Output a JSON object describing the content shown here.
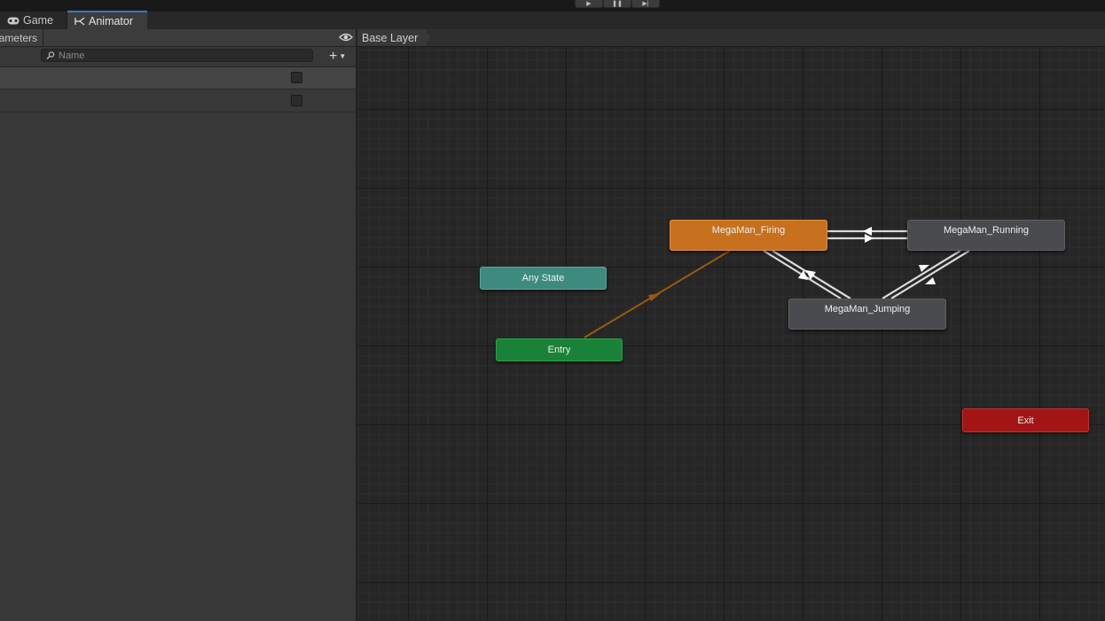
{
  "toolbar": {
    "play_icon": "▶",
    "pause_icon": "❚❚",
    "step_icon": "▶|"
  },
  "tabs": [
    {
      "label": "Game",
      "icon": "gamepad-icon"
    },
    {
      "label": "Animator",
      "icon": "animator-icon"
    }
  ],
  "left_panel": {
    "tab_label": "ameters",
    "search": {
      "placeholder": "Name",
      "value": ""
    },
    "add_symbol": "+",
    "parameters": [
      {
        "name": "",
        "type": "bool",
        "checked": false,
        "selected": true
      },
      {
        "name": "",
        "type": "bool",
        "checked": false,
        "selected": false
      }
    ]
  },
  "graph": {
    "breadcrumb": "Base Layer",
    "states": {
      "firing": "MegaMan_Firing",
      "running": "MegaMan_Running",
      "jumping": "MegaMan_Jumping",
      "any_state": "Any State",
      "entry": "Entry",
      "exit": "Exit"
    },
    "colors": {
      "default_state": "#c7701d",
      "state": "#4a4b4f",
      "any_state": "#3d8b7f",
      "entry": "#198238",
      "exit": "#a31414",
      "transition": "#d9d9d9",
      "default_transition": "#9a5a0c"
    }
  }
}
